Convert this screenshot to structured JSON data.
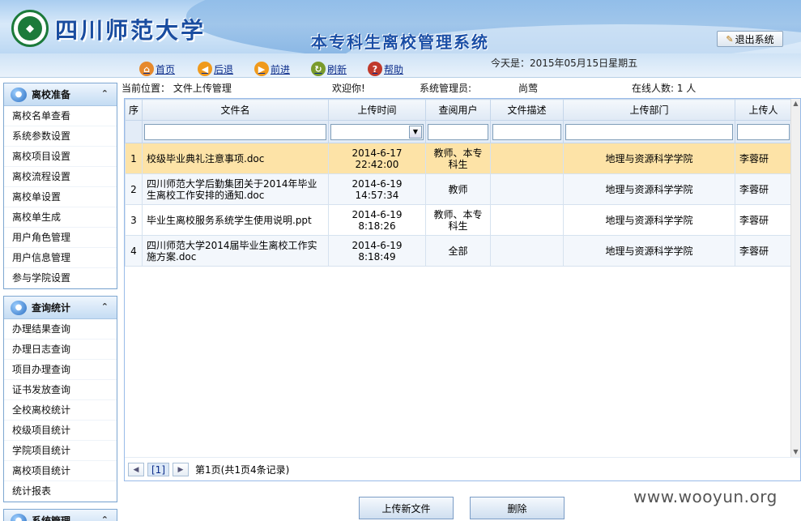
{
  "header": {
    "university": "四川师范大学",
    "system_title": "本专科生离校管理系统",
    "logout_label": "退出系统"
  },
  "toolbar": {
    "home": "首页",
    "back": "后退",
    "forward": "前进",
    "refresh": "刷新",
    "help": "帮助",
    "today": "今天是：2015年05月15日星期五"
  },
  "sidebar": {
    "panels": [
      {
        "title": "离校准备",
        "items": [
          "离校名单查看",
          "系统参数设置",
          "离校项目设置",
          "离校流程设置",
          "离校单设置",
          "离校单生成",
          "用户角色管理",
          "用户信息管理",
          "参与学院设置"
        ]
      },
      {
        "title": "查询统计",
        "items": [
          "办理结果查询",
          "办理日志查询",
          "项目办理查询",
          "证书发放查询",
          "全校离校统计",
          "校级项目统计",
          "学院项目统计",
          "离校项目统计",
          "统计报表"
        ]
      },
      {
        "title": "系统管理",
        "items": []
      }
    ]
  },
  "infobar": {
    "location": "当前位置：  文件上传管理",
    "welcome": "欢迎你!",
    "role": "系统管理员:",
    "user": "尚莺",
    "online": "在线人数: 1 人"
  },
  "grid": {
    "columns": [
      "序",
      "文件名",
      "上传时间",
      "查阅用户",
      "文件描述",
      "上传部门",
      "上传人"
    ],
    "rows": [
      {
        "no": "1",
        "name": "校级毕业典礼注意事项.doc",
        "time": "2014-6-17 22:42:00",
        "users": "教师、本专科生",
        "desc": "",
        "dept": "地理与资源科学学院",
        "uploader": "李蓉研"
      },
      {
        "no": "2",
        "name": "四川师范大学后勤集团关于2014年毕业生离校工作安排的通知.doc",
        "time": "2014-6-19 14:57:34",
        "users": "教师",
        "desc": "",
        "dept": "地理与资源科学学院",
        "uploader": "李蓉研"
      },
      {
        "no": "3",
        "name": "毕业生离校服务系统学生使用说明.ppt",
        "time": "2014-6-19 8:18:26",
        "users": "教师、本专科生",
        "desc": "",
        "dept": "地理与资源科学学院",
        "uploader": "李蓉研"
      },
      {
        "no": "4",
        "name": "四川师范大学2014届毕业生离校工作实施方案.doc",
        "time": "2014-6-19 8:18:49",
        "users": "全部",
        "desc": "",
        "dept": "地理与资源科学学院",
        "uploader": "李蓉研"
      }
    ],
    "pager": {
      "current_page": "[1]",
      "info": "第1页(共1页4条记录)"
    }
  },
  "buttons": {
    "upload": "上传新文件",
    "delete": "删除"
  },
  "watermark": "www.wooyun.org",
  "colors": {
    "selected_row": "#fde3a7",
    "header_blue": "#1a4da0",
    "link_blue": "#0b2c8a"
  }
}
